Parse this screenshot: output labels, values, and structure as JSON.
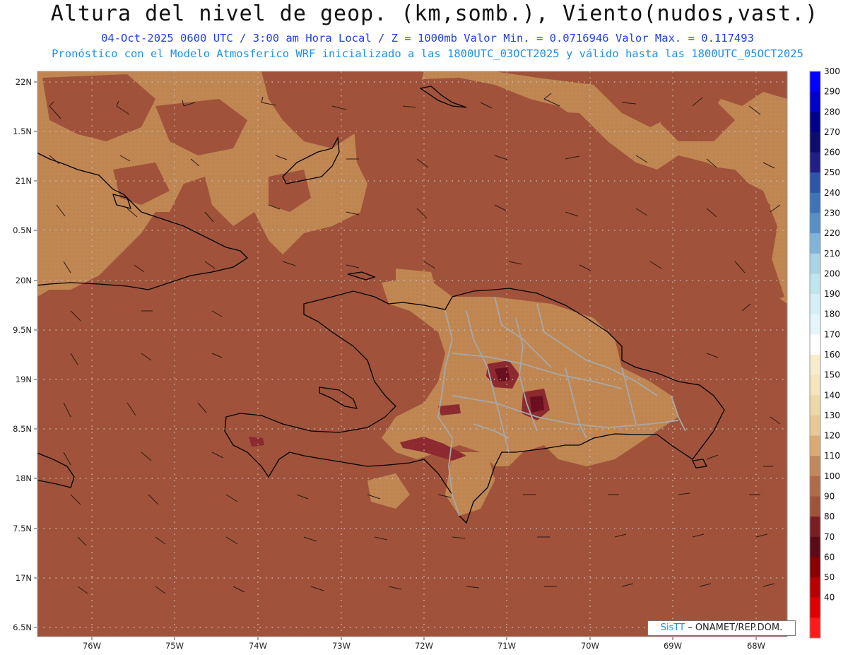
{
  "header": {
    "title": "Altura del nivel de geop. (km,somb.), Viento(nudos,vast.)",
    "line1": "04-Oct-2025  0600 UTC / 3:00 am Hora Local / Z = 1000mb  Valor Min. = 0.0716946  Valor Max. = 0.117493",
    "line2": "Pronóstico con el Modelo Atmosferico WRF inicializado a las 1800UTC_03OCT2025 y válido hasta las  1800UTC_05OCT2025"
  },
  "map": {
    "lat_labels": [
      "22N",
      "1.5N",
      "21N",
      "0.5N",
      "20N",
      "9.5N",
      "19N",
      "8.5N",
      "18N",
      "7.5N",
      "17N",
      "6.5N"
    ],
    "lon_labels": [
      "76W",
      "75W",
      "74W",
      "73W",
      "72W",
      "71W",
      "70W",
      "69W",
      "68W"
    ],
    "colors": {
      "ocean": "#a0533a",
      "land_light": "#c08753",
      "land_mid": "#b56e45",
      "dark": "#8c2a30",
      "darker": "#6a0f1f"
    }
  },
  "colorbar": {
    "levels": [
      "300",
      "290",
      "280",
      "270",
      "260",
      "250",
      "240",
      "230",
      "220",
      "210",
      "200",
      "190",
      "180",
      "170",
      "160",
      "150",
      "140",
      "130",
      "120",
      "110",
      "100",
      "90",
      "80",
      "70",
      "60",
      "50",
      "40"
    ],
    "colors": [
      "#0000ff",
      "#0000cc",
      "#00008a",
      "#0c0c6e",
      "#1f1f86",
      "#2d55a8",
      "#3f73b8",
      "#5590c8",
      "#80b4d8",
      "#a8d4e6",
      "#bfe6f0",
      "#d4eff6",
      "#e4f6fa",
      "#ffffff",
      "#f8eccc",
      "#f5e4bc",
      "#efd8a8",
      "#e8c894",
      "#d9aa72",
      "#c4875a",
      "#b06a48",
      "#a0533a",
      "#7a1e24",
      "#5e0a14",
      "#8a0000",
      "#b80000",
      "#e00000",
      "#ff1a1a"
    ]
  },
  "credit": {
    "logo": "SisTT",
    "text": " – ONAMET/REP.DOM."
  }
}
